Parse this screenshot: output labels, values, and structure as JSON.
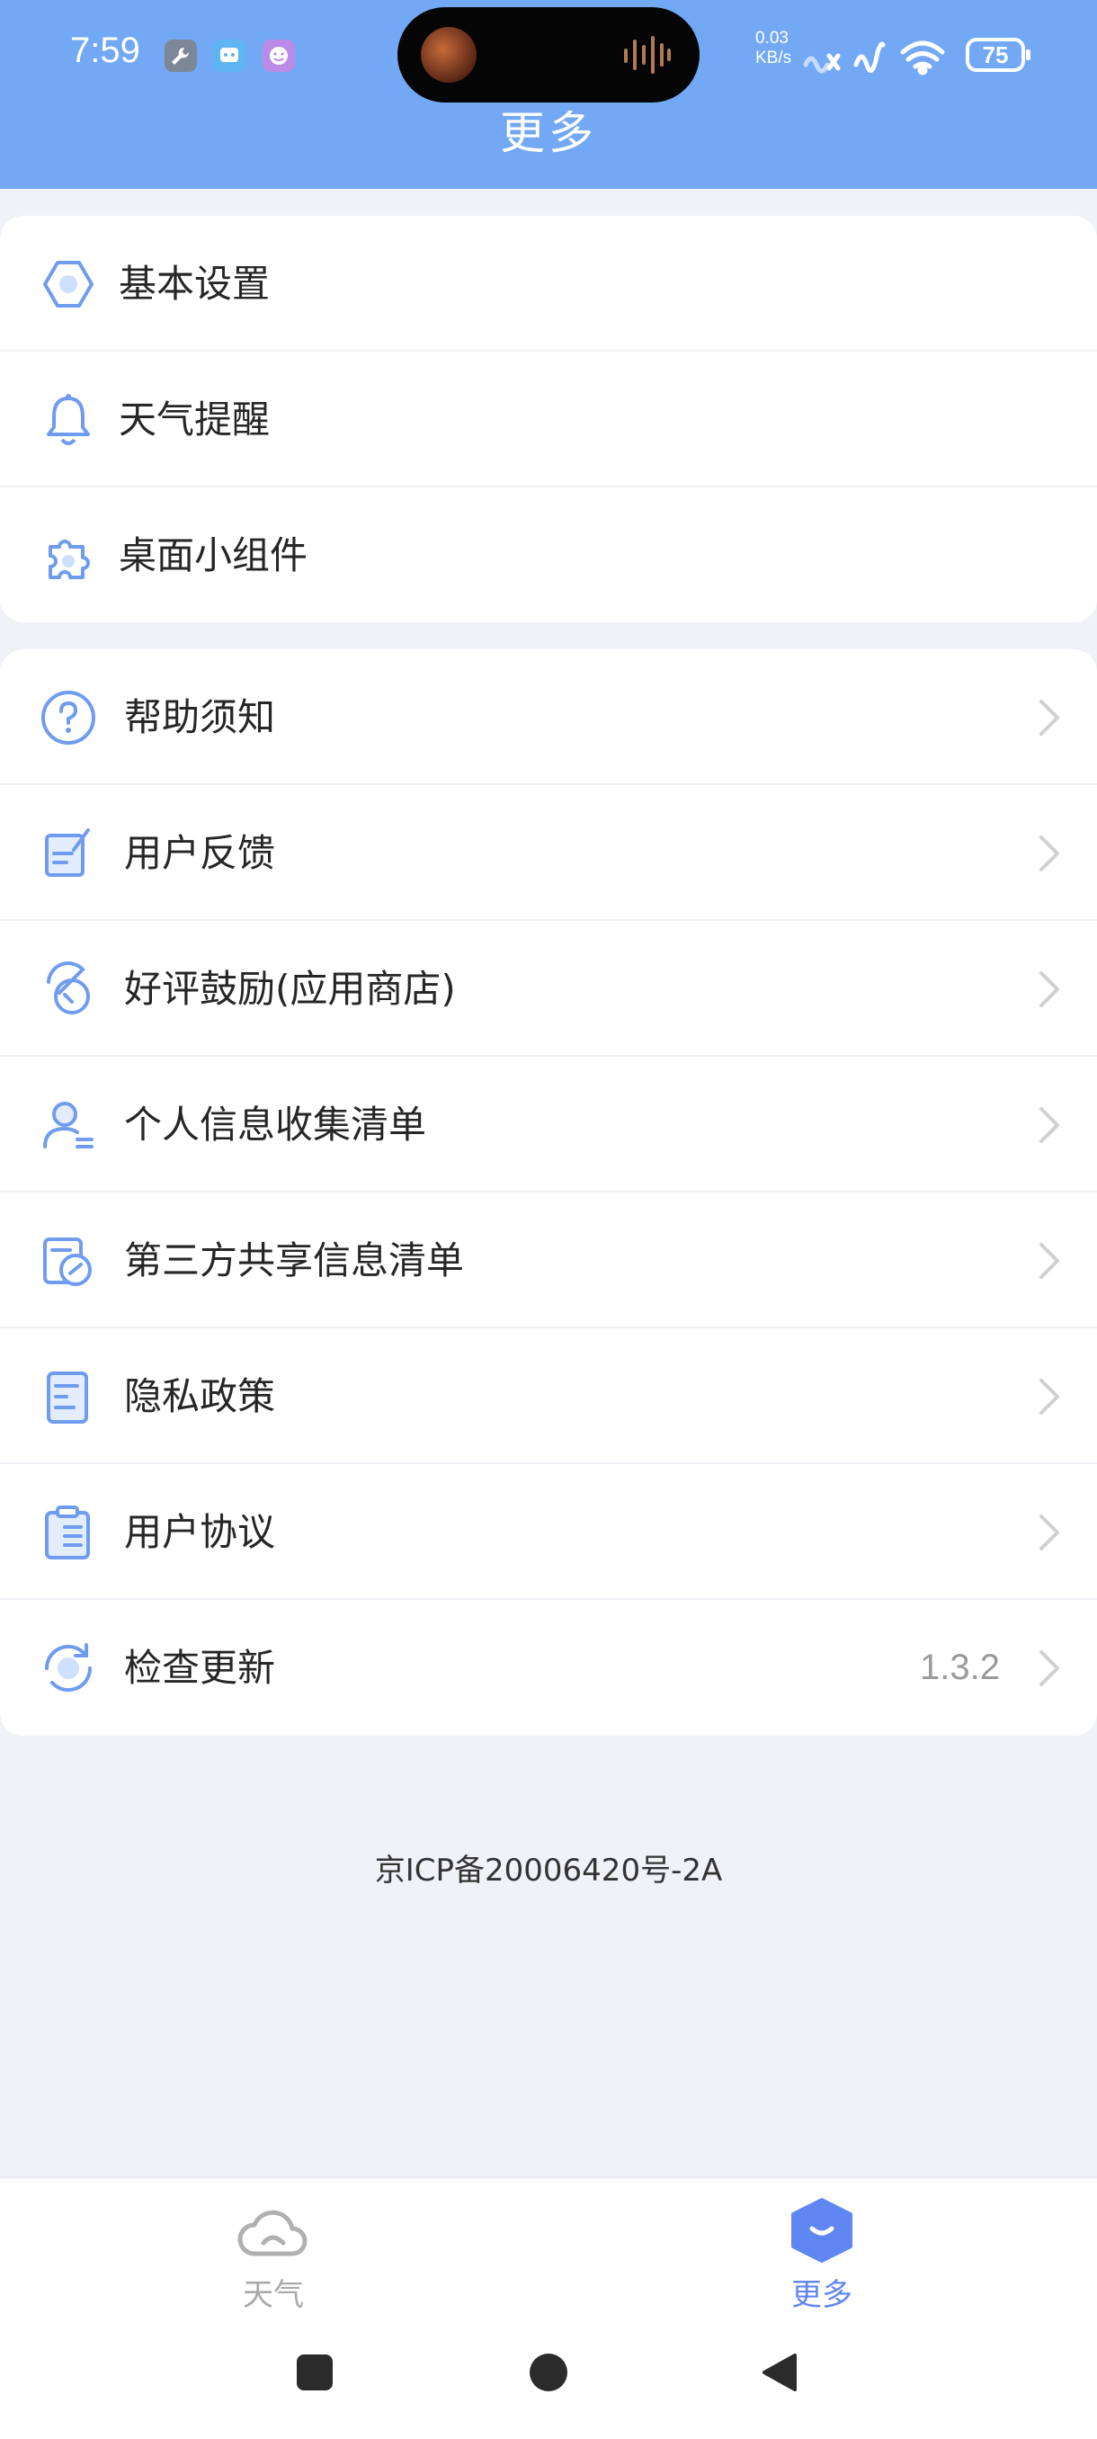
{
  "status_bar": {
    "time": "7:59",
    "net_speed_value": "0.03",
    "net_speed_unit": "KB/s",
    "battery": "75"
  },
  "header": {
    "title": "更多"
  },
  "settings_card": {
    "items": [
      {
        "label": "基本设置",
        "icon": "settings-hexagon-icon"
      },
      {
        "label": "天气提醒",
        "icon": "bell-icon"
      },
      {
        "label": "桌面小组件",
        "icon": "puzzle-widget-icon"
      }
    ]
  },
  "info_card": {
    "items": [
      {
        "label": "帮助须知",
        "icon": "help-question-icon"
      },
      {
        "label": "用户反馈",
        "icon": "feedback-edit-icon"
      },
      {
        "label": "好评鼓励(应用商店)",
        "icon": "rating-icon"
      },
      {
        "label": "个人信息收集清单",
        "icon": "personal-info-icon"
      },
      {
        "label": "第三方共享信息清单",
        "icon": "share-link-icon"
      },
      {
        "label": "隐私政策",
        "icon": "privacy-document-icon"
      },
      {
        "label": "用户协议",
        "icon": "agreement-clipboard-icon"
      },
      {
        "label": "检查更新",
        "icon": "refresh-update-icon",
        "value": "1.3.2"
      }
    ]
  },
  "footer": {
    "icp": "京ICP备20006420号-2A"
  },
  "tabbar": {
    "weather_label": "天气",
    "more_label": "更多"
  },
  "colors": {
    "header_bg": "#73a8f5",
    "icon_blue": "#6f9cf0",
    "active_tab": "#5f86f2",
    "inactive_tab": "#a9a9a9",
    "page_bg": "#f1f2f7"
  }
}
